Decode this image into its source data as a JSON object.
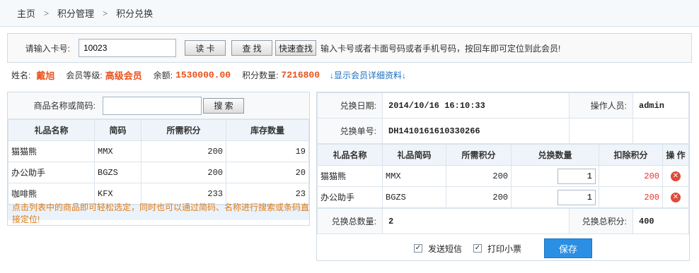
{
  "breadcrumb": {
    "home": "主页",
    "level2": "积分管理",
    "current": "积分兑换"
  },
  "search": {
    "label": "请输入卡号:",
    "card_value": "10023",
    "read_btn": "读 卡",
    "find_btn": "查 找",
    "quick_btn": "快速查找",
    "hint": "输入卡号或者卡面号码或者手机号码，按回车即可定位到此会员!"
  },
  "member": {
    "name_label": "姓名:",
    "name": "戴旭",
    "level_label": "会员等级:",
    "level": "高级会员",
    "balance_label": "余额:",
    "balance": "1530000.00",
    "points_label": "积分数量:",
    "points": "7216800",
    "detail_link": "↓显示会员详细资料↓"
  },
  "gift_search": {
    "label": "商品名称或简码:",
    "value": "",
    "button": "搜 索"
  },
  "gift_table": {
    "headers": [
      "礼品名称",
      "简码",
      "所需积分",
      "库存数量"
    ],
    "rows": [
      [
        "猫猫熊",
        "MMX",
        "200",
        "19"
      ],
      [
        "办公助手",
        "BGZS",
        "200",
        "20"
      ],
      [
        "咖啡熊",
        "KFX",
        "233",
        "23"
      ]
    ]
  },
  "tip": "点击列表中的商品即可轻松选定，同时也可以通过简码、名称进行搜索或条码直接定位!",
  "exchange": {
    "date_label": "兑换日期:",
    "date": "2014/10/16 16:10:33",
    "operator_label": "操作人员:",
    "operator": "admin",
    "order_label": "兑换单号:",
    "order": "DH1410161610330266",
    "headers": [
      "礼品名称",
      "礼品简码",
      "所需积分",
      "兑换数量",
      "扣除积分",
      "操 作"
    ],
    "rows": [
      [
        "猫猫熊",
        "MMX",
        "200",
        "1",
        "200"
      ],
      [
        "办公助手",
        "BGZS",
        "200",
        "1",
        "200"
      ]
    ],
    "total_qty_label": "兑换总数量:",
    "total_qty": "2",
    "total_points_label": "兑换总积分:",
    "total_points": "400",
    "sms_label": "发送短信",
    "print_label": "打印小票",
    "save_label": "保存"
  }
}
